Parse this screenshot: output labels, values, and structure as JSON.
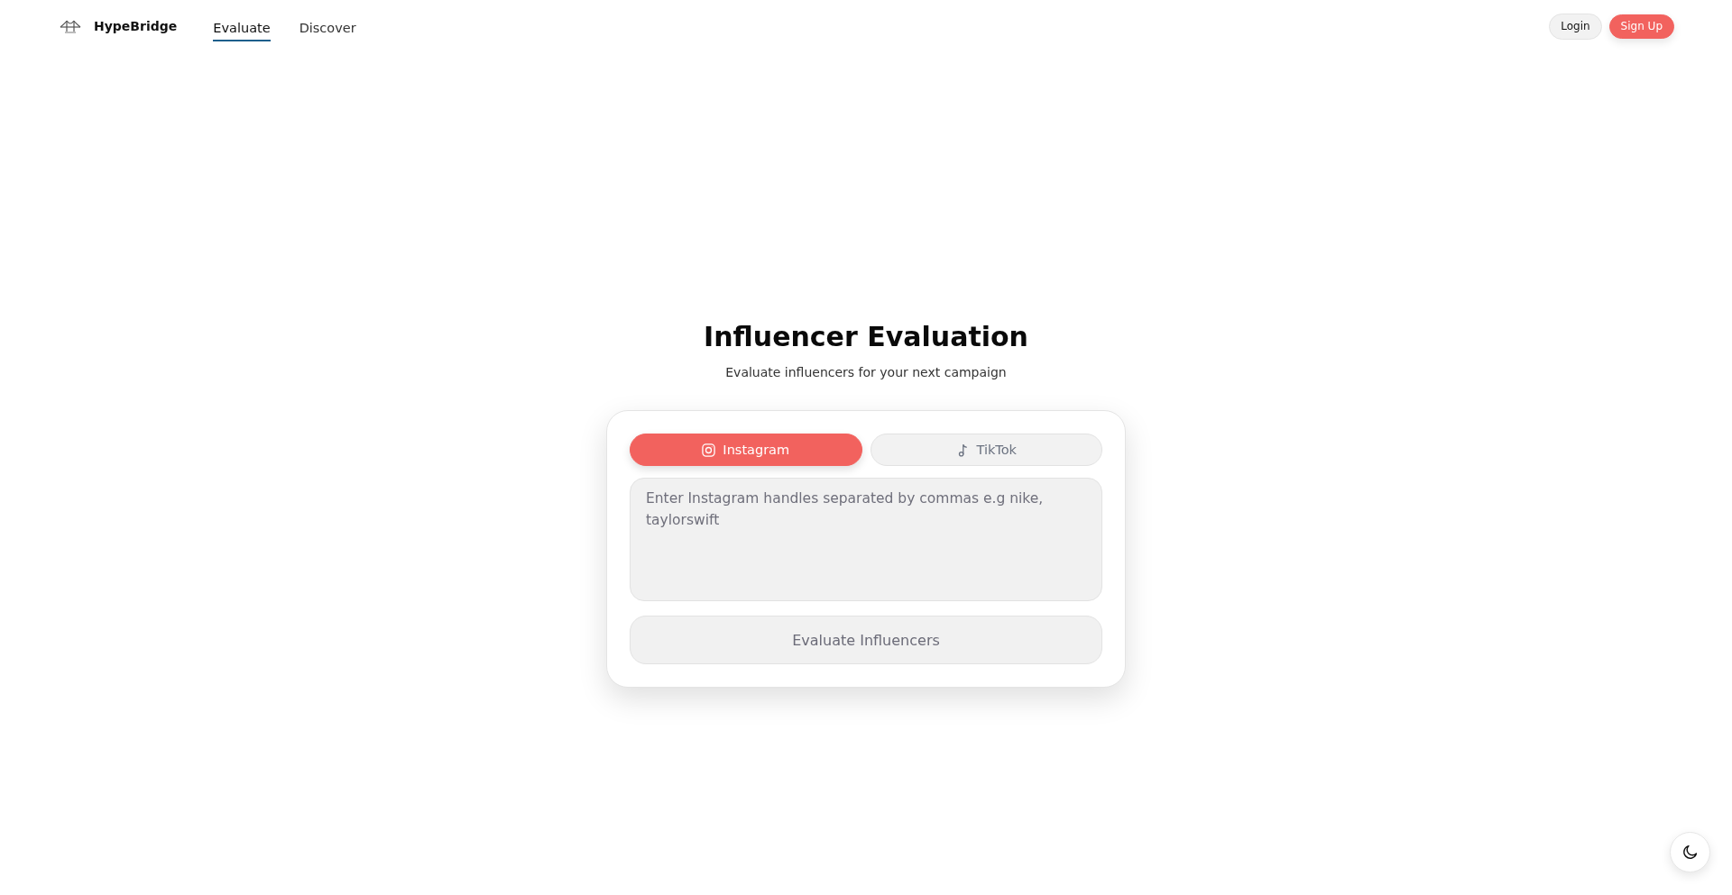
{
  "header": {
    "brand": "HypeBridge",
    "nav": [
      {
        "label": "Evaluate",
        "selected": true
      },
      {
        "label": "Discover",
        "selected": false
      }
    ],
    "buttons": [
      {
        "label": "Login",
        "kind": "secondary"
      },
      {
        "label": "Sign Up",
        "kind": "primary"
      }
    ]
  },
  "main": {
    "title": "Influencer Evaluation",
    "subtitle": "Evaluate influencers for your next campaign"
  },
  "card": {
    "platforms": [
      {
        "label": "Instagram",
        "kind": "instagram",
        "selected": true
      },
      {
        "label": "TikTok",
        "kind": "tiktok",
        "selected": false
      }
    ],
    "input": {
      "placeholder": "Enter Instagram handles separated by commas e.g nike, taylorswift"
    },
    "submit": "Evaluate Influencers"
  }
}
